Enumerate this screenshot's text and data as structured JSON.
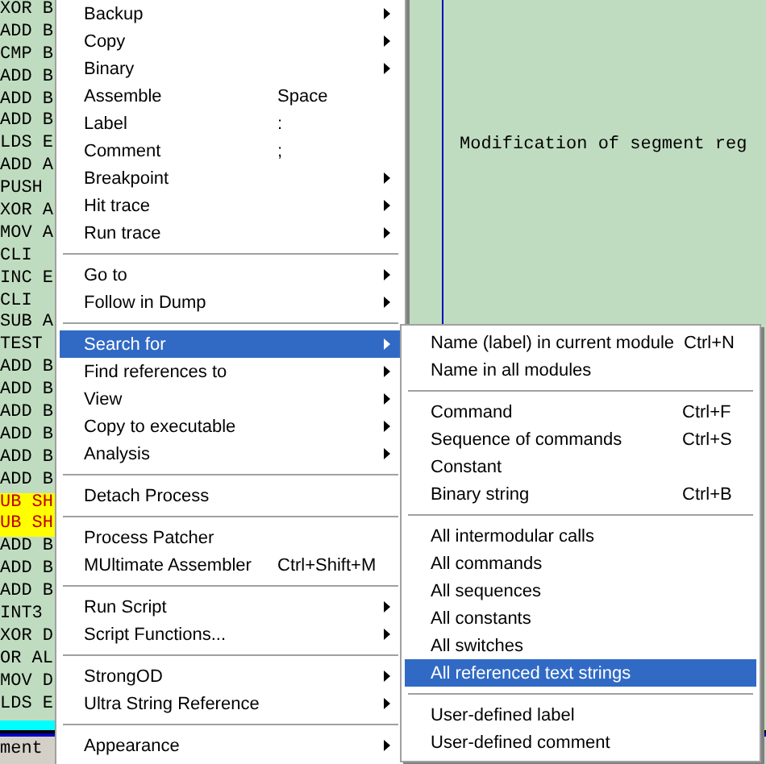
{
  "code_listing": {
    "lines": [
      {
        "text": "XOR B",
        "highlighted": false
      },
      {
        "text": "ADD B",
        "highlighted": false
      },
      {
        "text": "CMP B",
        "highlighted": false
      },
      {
        "text": "ADD B",
        "highlighted": false
      },
      {
        "text": "ADD B",
        "highlighted": false
      },
      {
        "text": "ADD B",
        "highlighted": false
      },
      {
        "text": "LDS E",
        "highlighted": false
      },
      {
        "text": "ADD A",
        "highlighted": false
      },
      {
        "text": "PUSH",
        "highlighted": false
      },
      {
        "text": "XOR A",
        "highlighted": false
      },
      {
        "text": "MOV A",
        "highlighted": false
      },
      {
        "text": "CLI",
        "highlighted": false
      },
      {
        "text": "INC E",
        "highlighted": false
      },
      {
        "text": "CLI",
        "highlighted": false
      },
      {
        "text": "SUB A",
        "highlighted": false
      },
      {
        "text": "TEST",
        "highlighted": false
      },
      {
        "text": "ADD B",
        "highlighted": false
      },
      {
        "text": "ADD B",
        "highlighted": false
      },
      {
        "text": "ADD B",
        "highlighted": false
      },
      {
        "text": "ADD B",
        "highlighted": false
      },
      {
        "text": "ADD B",
        "highlighted": false
      },
      {
        "text": "ADD B",
        "highlighted": false
      },
      {
        "text": "UB SH",
        "highlighted": true
      },
      {
        "text": "UB SH",
        "highlighted": true
      },
      {
        "text": "ADD B",
        "highlighted": false
      },
      {
        "text": "ADD B",
        "highlighted": false
      },
      {
        "text": "ADD B",
        "highlighted": false
      },
      {
        "text": "INT3",
        "highlighted": false
      },
      {
        "text": "XOR D",
        "highlighted": false
      },
      {
        "text": "OR AL",
        "highlighted": false
      },
      {
        "text": "MOV D",
        "highlighted": false
      },
      {
        "text": "LDS E",
        "highlighted": false
      }
    ]
  },
  "comment_pane": {
    "text": "Modification of segment reg"
  },
  "status_label": "ment",
  "context_menu": {
    "groups": [
      [
        {
          "label": "Backup",
          "has_submenu": true,
          "selected": false
        },
        {
          "label": "Copy",
          "has_submenu": true,
          "selected": false
        },
        {
          "label": "Binary",
          "has_submenu": true,
          "selected": false
        },
        {
          "label": "Assemble",
          "shortcut": "Space",
          "has_submenu": false,
          "selected": false
        },
        {
          "label": "Label",
          "shortcut": ":",
          "has_submenu": false,
          "selected": false
        },
        {
          "label": "Comment",
          "shortcut": ";",
          "has_submenu": false,
          "selected": false
        },
        {
          "label": "Breakpoint",
          "has_submenu": true,
          "selected": false
        },
        {
          "label": "Hit trace",
          "has_submenu": true,
          "selected": false
        },
        {
          "label": "Run trace",
          "has_submenu": true,
          "selected": false
        }
      ],
      [
        {
          "label": "Go to",
          "has_submenu": true,
          "selected": false
        },
        {
          "label": "Follow in Dump",
          "has_submenu": true,
          "selected": false
        }
      ],
      [
        {
          "label": "Search for",
          "has_submenu": true,
          "selected": true
        },
        {
          "label": "Find references to",
          "has_submenu": true,
          "selected": false
        },
        {
          "label": "View",
          "has_submenu": true,
          "selected": false
        },
        {
          "label": "Copy to executable",
          "has_submenu": true,
          "selected": false
        },
        {
          "label": "Analysis",
          "has_submenu": true,
          "selected": false
        }
      ],
      [
        {
          "label": "Detach Process",
          "has_submenu": false,
          "selected": false
        }
      ],
      [
        {
          "label": "Process Patcher",
          "has_submenu": false,
          "selected": false
        },
        {
          "label": "MUltimate Assembler",
          "shortcut": "Ctrl+Shift+M",
          "has_submenu": false,
          "selected": false
        }
      ],
      [
        {
          "label": "Run Script",
          "has_submenu": true,
          "selected": false
        },
        {
          "label": "Script Functions...",
          "has_submenu": true,
          "selected": false
        }
      ],
      [
        {
          "label": "StrongOD",
          "has_submenu": true,
          "selected": false
        },
        {
          "label": "Ultra String Reference",
          "has_submenu": true,
          "selected": false
        }
      ],
      [
        {
          "label": "Appearance",
          "has_submenu": true,
          "selected": false
        }
      ]
    ]
  },
  "submenu": {
    "groups": [
      [
        {
          "label": "Name (label) in current module",
          "shortcut": "Ctrl+N",
          "selected": false
        },
        {
          "label": "Name in all modules",
          "selected": false
        }
      ],
      [
        {
          "label": "Command",
          "shortcut": "Ctrl+F",
          "selected": false
        },
        {
          "label": "Sequence of commands",
          "shortcut": "Ctrl+S",
          "selected": false
        },
        {
          "label": "Constant",
          "selected": false
        },
        {
          "label": "Binary string",
          "shortcut": "Ctrl+B",
          "selected": false
        }
      ],
      [
        {
          "label": "All intermodular calls",
          "selected": false
        },
        {
          "label": "All commands",
          "selected": false
        },
        {
          "label": "All sequences",
          "selected": false
        },
        {
          "label": "All constants",
          "selected": false
        },
        {
          "label": "All switches",
          "selected": false
        },
        {
          "label": "All referenced text strings",
          "selected": true
        }
      ],
      [
        {
          "label": "User-defined label",
          "selected": false
        },
        {
          "label": "User-defined comment",
          "selected": false
        }
      ]
    ]
  }
}
